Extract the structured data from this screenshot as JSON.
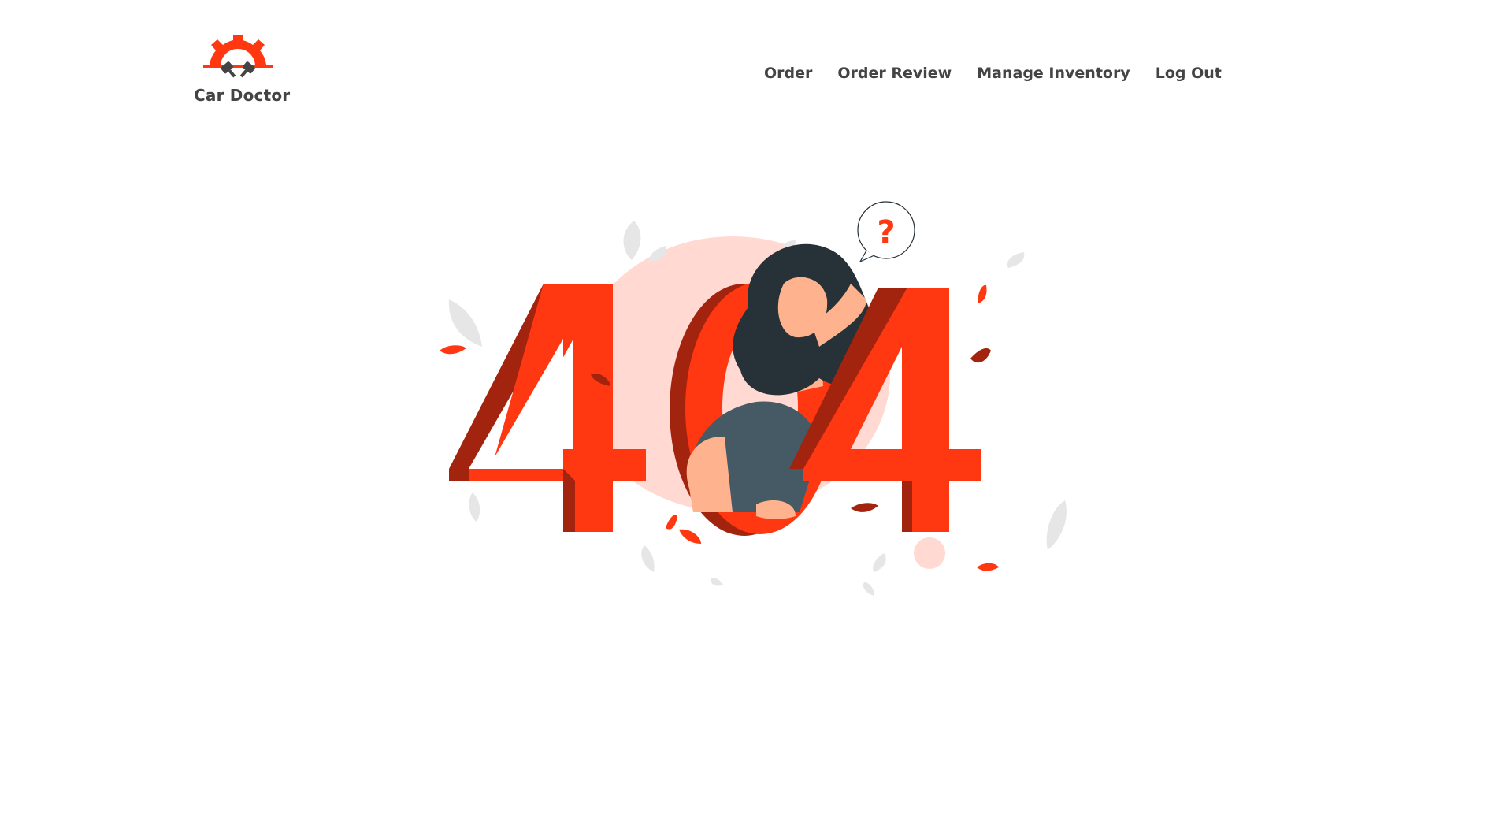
{
  "brand": {
    "name": "Car Doctor",
    "logo_icon": "gear-pistons-icon"
  },
  "nav": {
    "items": [
      {
        "label": "Order"
      },
      {
        "label": "Order Review"
      },
      {
        "label": "Manage Inventory"
      },
      {
        "label": "Log Out"
      }
    ]
  },
  "illustration": {
    "digits": [
      "4",
      "0",
      "4"
    ],
    "speech_bubble": "?",
    "icon": "not-found-illustration"
  },
  "colors": {
    "accent": "#FF3811",
    "accent_dark": "#A2230E",
    "blush": "#FFD9D2",
    "text": "#444444",
    "leaf_grey": "#E6E6E6",
    "hair": "#263238",
    "shirt": "#455A64",
    "skin": "#FFB28E"
  }
}
